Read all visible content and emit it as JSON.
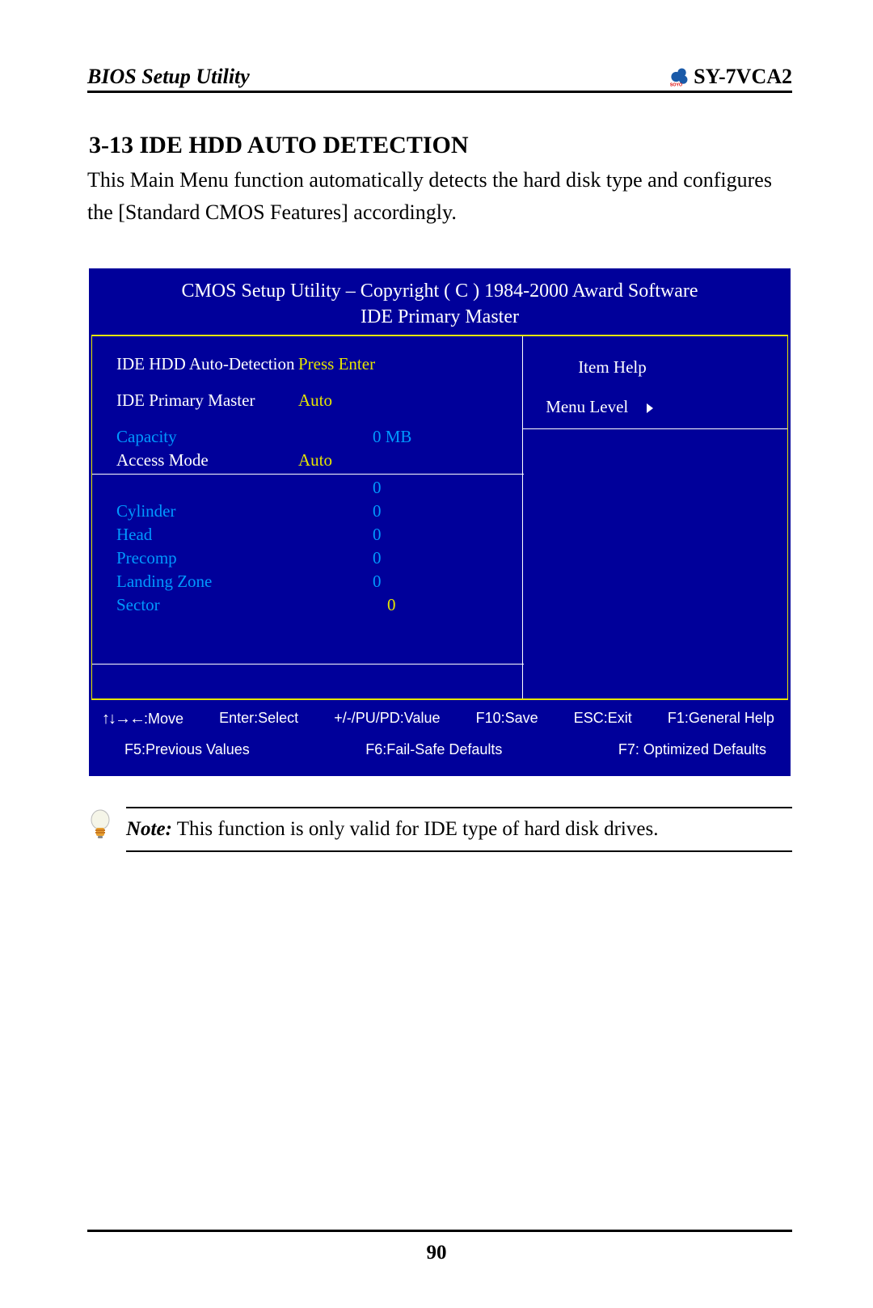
{
  "header": {
    "left": "BIOS Setup Utility",
    "right": "SY-7VCA2",
    "logo_brand": "SOYO"
  },
  "section": {
    "number_title": "3-13  IDE HDD AUTO DETECTION",
    "body": "This Main Menu function automatically detects the hard disk type and configures the [Standard CMOS Features] accordingly."
  },
  "bios": {
    "title_line1": "CMOS Setup Utility – Copyright ( C ) 1984-2000 Award Software",
    "title_line2": "IDE Primary Master",
    "rows": {
      "auto_detect_label": "IDE HDD Auto-Detection",
      "auto_detect_value": "Press Enter",
      "primary_master_label": "IDE Primary Master",
      "primary_master_value": "Auto",
      "capacity_label": "Capacity",
      "capacity_value": "0 MB",
      "access_mode_label": "Access Mode",
      "access_mode_value": "Auto",
      "blank_value": "0",
      "cylinder_label": "Cylinder",
      "cylinder_value": "0",
      "head_label": "Head",
      "head_value": "0",
      "precomp_label": "Precomp",
      "precomp_value": "0",
      "landing_zone_label": "Landing Zone",
      "landing_zone_value": "0",
      "sector_label": "Sector",
      "sector_value": "0"
    },
    "help": {
      "item_help": "Item Help",
      "menu_level": "Menu Level"
    },
    "footer": {
      "move": ":Move",
      "enter": "Enter:Select",
      "pupd": "+/-/PU/PD:Value",
      "f10": "F10:Save",
      "esc": "ESC:Exit",
      "f1": "F1:General Help",
      "f5": "F5:Previous Values",
      "f6": "F6:Fail-Safe Defaults",
      "f7": "F7: Optimized Defaults"
    }
  },
  "note": {
    "label": "Note:",
    "text": " This function is only valid for IDE type of hard disk drives."
  },
  "page_number": "90"
}
